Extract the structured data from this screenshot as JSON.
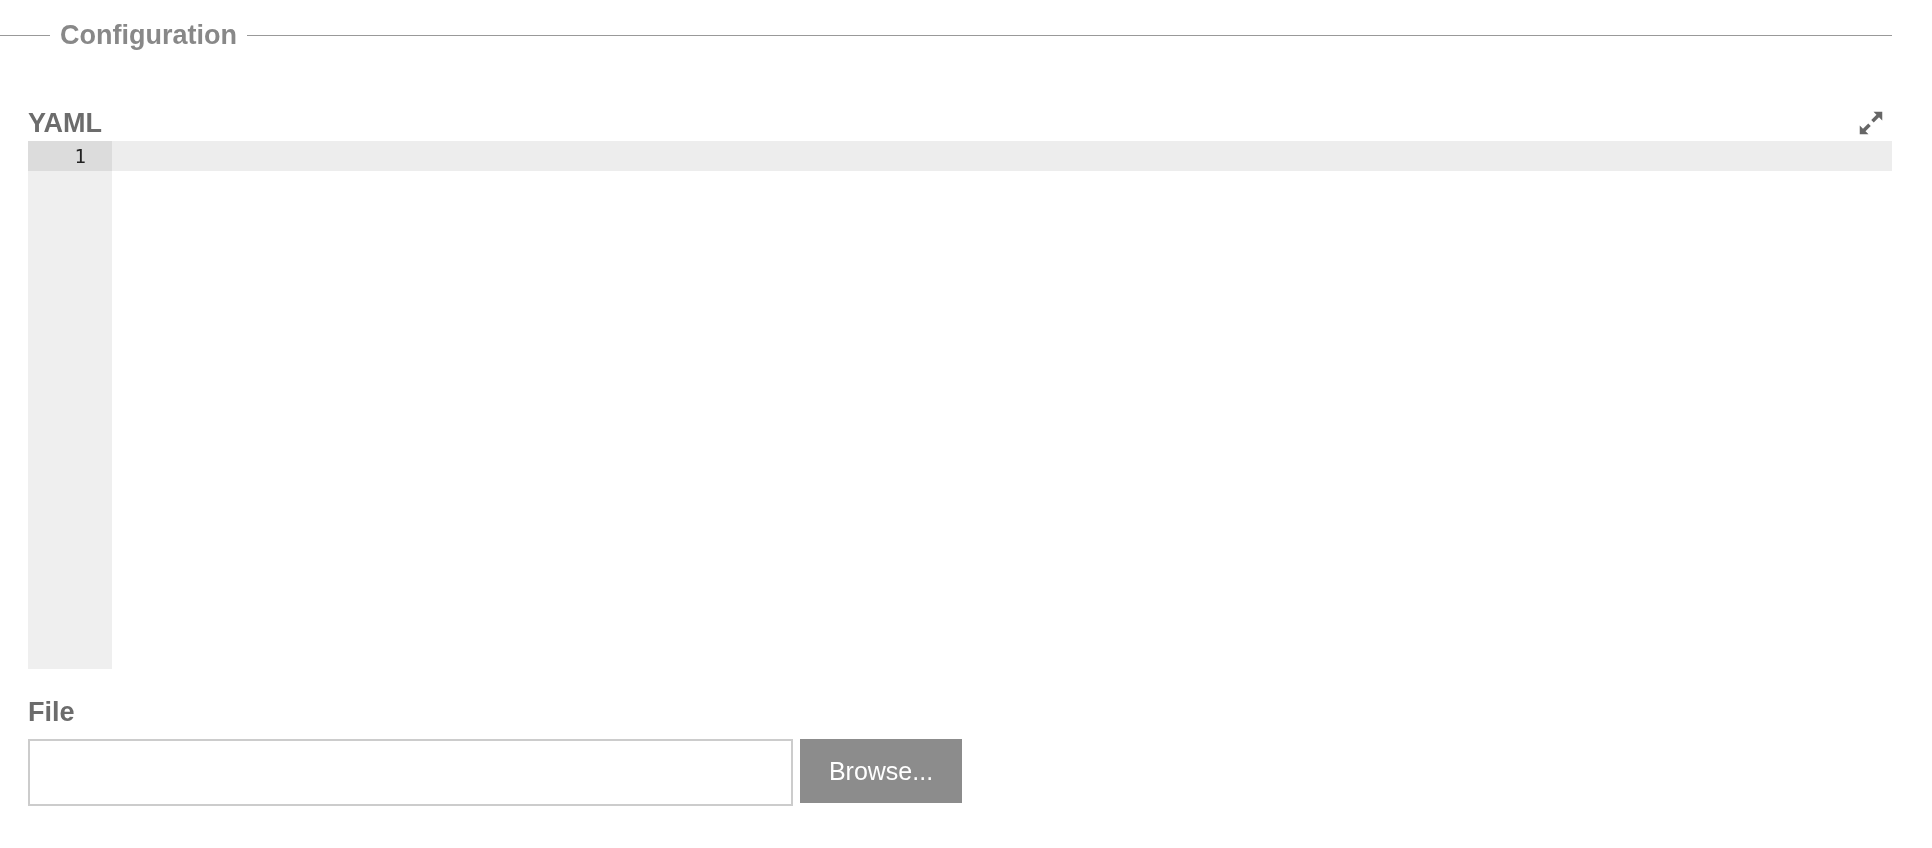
{
  "fieldset": {
    "legend": "Configuration"
  },
  "editor": {
    "label": "YAML",
    "lines": [
      {
        "number": "1",
        "active": true
      }
    ]
  },
  "file": {
    "label": "File",
    "button": "Browse..."
  }
}
